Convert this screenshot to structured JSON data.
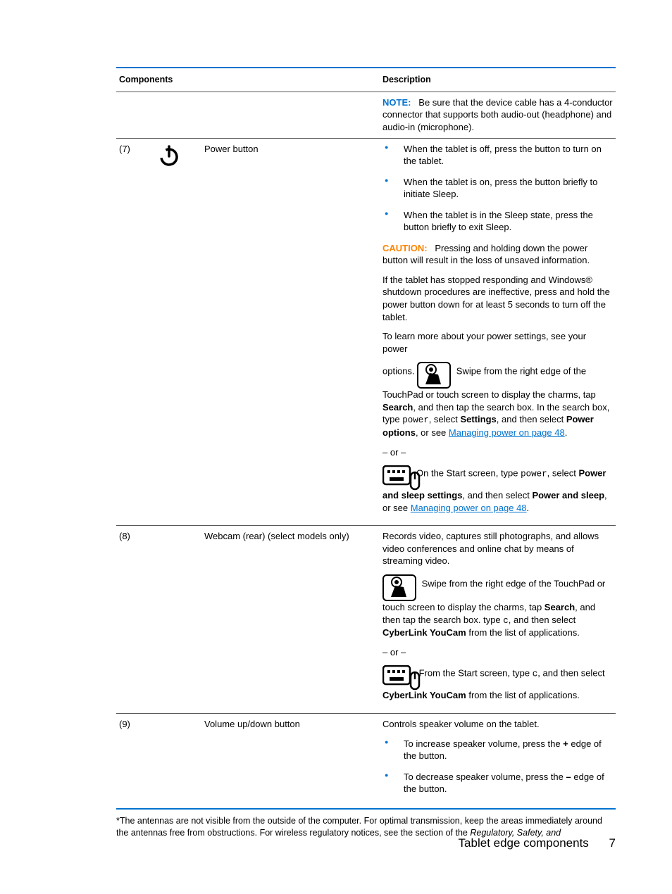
{
  "headers": {
    "c1": "Components",
    "c2": "Description"
  },
  "row_note": {
    "label": "NOTE:",
    "text": "Be sure that the device cable has a 4-conductor connector that supports both audio-out (headphone) and audio-in (microphone)."
  },
  "row7": {
    "num": "(7)",
    "component": "Power button",
    "b1": "When the tablet is off, press the button to turn on the tablet.",
    "b2": "When the tablet is on, press the button briefly to initiate Sleep.",
    "b3": "When the tablet is in the Sleep state, press the button briefly to exit Sleep.",
    "caution_label": "CAUTION:",
    "caution_text": "Pressing and holding down the power button will result in the loss of unsaved information.",
    "p1": "If the tablet has stopped responding and Windows® shutdown procedures are ineffective, press and hold the power button down for at least 5 seconds to turn off the tablet.",
    "p2a": "To learn more about your power settings, see your power",
    "p2b": "options.",
    "p2c": "Swipe from the right edge of the",
    "p3a": "TouchPad or touch screen to display the charms, tap ",
    "p3_search": "Search",
    "p3b": ", and then tap the search box. In the search box, type ",
    "p3_power": "power",
    "p3c": ", select ",
    "p3_settings": "Settings",
    "p3d": ", and then select ",
    "p3_poweropts": "Power options",
    "p3e": ", or see ",
    "p3_link": "Managing power on page 48",
    "p3f": ".",
    "or": "– or –",
    "p4a": "On the Start screen, type ",
    "p4_power": "power",
    "p4b": ", select ",
    "p4_power_bold": "Power",
    "p5a": "and sleep settings",
    "p5b": ", and then select ",
    "p5_pas": "Power and sleep",
    "p5c": ", or see ",
    "p5_link": "Managing power on page 48",
    "p5d": "."
  },
  "row8": {
    "num": "(8)",
    "component": "Webcam (rear) (select models only)",
    "p1": "Records video, captures still photographs, and allows video conferences and online chat by means of streaming video.",
    "p2": "Swipe from the right edge of the TouchPad or",
    "p3a": "touch screen to display the charms, tap ",
    "p3_search": "Search",
    "p3b": ", and then tap the search box. type ",
    "p3_c": "c",
    "p3c": ", and then select ",
    "p3_cyber": "CyberLink YouCam",
    "p3d": " from the list of applications.",
    "or": "– or –",
    "p4a": "From the Start screen, type ",
    "p4_c": "c",
    "p4b": ", and then select",
    "p5_cyber": "CyberLink YouCam",
    "p5a": " from the list of applications."
  },
  "row9": {
    "num": "(9)",
    "component": "Volume up/down button",
    "p1": "Controls speaker volume on the tablet.",
    "b1a": "To increase speaker volume, press the ",
    "b1_plus": "+",
    "b1b": " edge of the button.",
    "b2a": "To decrease speaker volume, press the ",
    "b2_minus": "–",
    "b2b": " edge of the button."
  },
  "footnote": {
    "a": "*The antennas are not visible from the outside of the computer. For optimal transmission, keep the areas immediately around the antennas free from obstructions. For wireless regulatory notices, see the section of the ",
    "b": "Regulatory, Safety, and"
  },
  "footer": {
    "title": "Tablet edge components",
    "page": "7"
  }
}
